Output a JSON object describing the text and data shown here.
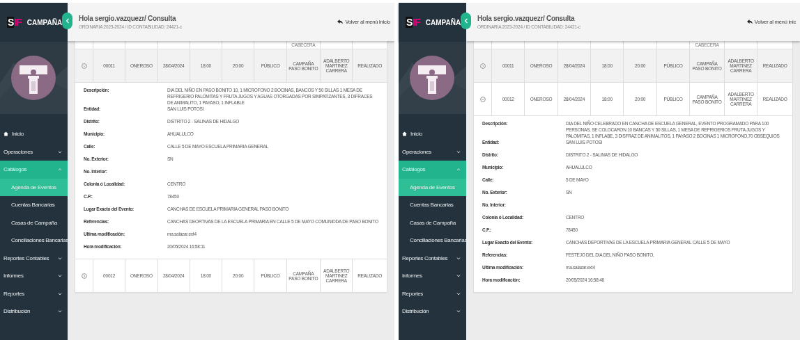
{
  "panels": [
    {
      "logo": {
        "mark_left": "S",
        "mark_right": "IF",
        "brand": "CAMPAÑA"
      },
      "header": {
        "greeting": "Hola sergio.vazquezr/ Consulta",
        "subtitle": "ORDINARIA 2023-2024 / ID CONTABILIDAD: 24421-c",
        "back_link": "Volver al menú inicio"
      },
      "menu": [
        {
          "label": "Inicio",
          "kind": "home",
          "selected": false
        },
        {
          "label": "Operaciones",
          "kind": "group",
          "expanded": false,
          "selected": false
        },
        {
          "label": "Catálogos",
          "kind": "group",
          "expanded": true,
          "selected": true,
          "children": [
            {
              "label": "Agenda de Eventos",
              "selected": true
            },
            {
              "label": "Cuentas Bancarias",
              "selected": false
            },
            {
              "label": "Casas de Campaña",
              "selected": false
            },
            {
              "label": "Conciliaciones Bancarias",
              "selected": false
            }
          ]
        },
        {
          "label": "Reportes Contables",
          "kind": "group",
          "expanded": false,
          "selected": false
        },
        {
          "label": "Informes",
          "kind": "group",
          "expanded": false,
          "selected": false
        },
        {
          "label": "Reportes",
          "kind": "group",
          "expanded": false,
          "selected": false
        },
        {
          "label": "Distribución",
          "kind": "group",
          "expanded": false,
          "selected": false
        }
      ],
      "partial_header": "CABECERA",
      "rows": [
        {
          "cells": [
            "00011",
            "ONEROSO",
            "28/04/2024",
            "18:00",
            "20:00",
            "PÚBLICO",
            "CAMPAÑA PASO BONITO",
            "ADALBERTO MARTINEZ CARRERA",
            "REALIZADO"
          ],
          "expanded": true,
          "details": [
            {
              "label": "Descripción:",
              "value": "DIA DEL NIÑO EN PASO BONITO 10, 1 MICROFONO 2 BOCINAS, BANCOS Y 50 SILLAS 1 MESA DE REFRIGERIO PALOMITAS Y FRUTA JUGOS Y AGUAS OTORGADAS POR SIMPATIZANTES, 3 DIFRACES DE ANIMALITO, 1 PAYASO, 1 INFLABLE"
            },
            {
              "label": "Entidad:",
              "value": "SAN LUIS POTOSI"
            },
            {
              "label": "Distrito:",
              "value": "DISTRITO 2 - SALINAS DE HIDALGO"
            },
            {
              "label": "Municipio:",
              "value": "AHUALULCO"
            },
            {
              "label": "Calle:",
              "value": "CALLE 5 DE MAYO ESCUELA PRIMARIA GENERAL"
            },
            {
              "label": "No. Exterior:",
              "value": "SN"
            },
            {
              "label": "No. Interior:"
            },
            {
              "label": "Colonia ó Localidad:",
              "value": "CENTRO"
            },
            {
              "label": "C.P.:",
              "value": "78450"
            },
            {
              "label": "Lugar Exacto del Evento:",
              "value": "CANCHAS DE ESCUELA PRIMARIA GENERAL PASO BONITO"
            },
            {
              "label": "Referencias:",
              "value": "CANCHAS DEORTIVAS DE LA ESCUELA PRIMARIA EN CALLE 5 DE MAYO COMUNIDDA DE PASO BONITO"
            },
            {
              "label": "Ultima modificación:",
              "value": "ma.salazar.ext4"
            },
            {
              "label": "Hora modificación:",
              "value": "20/05/2024 16:58:11"
            }
          ]
        },
        {
          "cells": [
            "00012",
            "ONEROSO",
            "28/04/2024",
            "18:00",
            "20:00",
            "PÚBLICO",
            "CAMPAÑA PASO BONITO",
            "ADALBERTO MARTINEZ CARRERA",
            "REALIZADO"
          ],
          "expanded": false
        }
      ]
    },
    {
      "logo": {
        "mark_left": "S",
        "mark_right": "IF",
        "brand": "CAMPAÑA"
      },
      "header": {
        "greeting": "Hola sergio.vazquezr/ Consulta",
        "subtitle": "ORDINARIA 2023-2024 / ID CONTABILIDAD: 24421-c",
        "back_link": "Volver al menú inic"
      },
      "menu": [
        {
          "label": "Inicio",
          "kind": "home",
          "selected": false
        },
        {
          "label": "Operaciones",
          "kind": "group",
          "expanded": false,
          "selected": false
        },
        {
          "label": "Catálogos",
          "kind": "group",
          "expanded": true,
          "selected": true,
          "children": [
            {
              "label": "Agenda de Eventos",
              "selected": true
            },
            {
              "label": "Cuentas Bancarias",
              "selected": false
            },
            {
              "label": "Casas de Campaña",
              "selected": false
            },
            {
              "label": "Conciliaciones Bancarias",
              "selected": false
            }
          ]
        },
        {
          "label": "Reportes Contables",
          "kind": "group",
          "expanded": false,
          "selected": false
        },
        {
          "label": "Informes",
          "kind": "group",
          "expanded": false,
          "selected": false
        },
        {
          "label": "Reportes",
          "kind": "group",
          "expanded": false,
          "selected": false
        },
        {
          "label": "Distribución",
          "kind": "group",
          "expanded": false,
          "selected": false
        }
      ],
      "partial_header": "CABECERA",
      "rows": [
        {
          "cells": [
            "00011",
            "ONEROSO",
            "28/04/2024",
            "18:00",
            "20:00",
            "PÚBLICO",
            "CAMPAÑA PASO BONITO",
            "ADALBERTO MARTINEZ CARRERA",
            "REALIZADO"
          ],
          "expanded": false
        },
        {
          "cells": [
            "00012",
            "ONEROSO",
            "28/04/2024",
            "18:00",
            "20:00",
            "PÚBLICO",
            "CAMPAÑA PASO BONITO",
            "ADALBERTO MARTINEZ CARRERA",
            "REALIZADO"
          ],
          "expanded": true,
          "details": [
            {
              "label": "Descripción:",
              "value": "DIA DEL NIÑO CELEBRADO EN CANCHA DE ESCUELA GENERAL, EVENTO PROGRAMADO PARA 100 PERSONAS, SE COLOCARON 10 BANCAS Y 50 SILLAS, 1 MESA DE REFRIGERIOS FRUTA JUGOS Y PALOMITAS, 1 INFLABE, 3 DISFRAZ DE ANIMALITOS, 1 PAYASO 2 BOCINAS 1 MICROFONO,70 OBSEQUIOS"
            },
            {
              "label": "Entidad:",
              "value": "SAN LUIS POTOSI"
            },
            {
              "label": "Distrito:",
              "value": "DISTRITO 2 - SALINAS DE HIDALGO"
            },
            {
              "label": "Municipio:",
              "value": "AHUALULCO"
            },
            {
              "label": "Calle:",
              "value": "5 DE MAYO"
            },
            {
              "label": "No. Exterior:",
              "value": "SN"
            },
            {
              "label": "No. Interior:"
            },
            {
              "label": "Colonia ó Localidad:",
              "value": "CENTRO"
            },
            {
              "label": "C.P.:",
              "value": "78450"
            },
            {
              "label": "Lugar Exacto del Evento:",
              "value": "CANCHAS DEPORTIVAS DE LA ESCUELA PRIMARIA GENERAL CALLE 5 DE MAYO"
            },
            {
              "label": "Referencias:",
              "value": "FESTEJO DEL DIA DEL NIÑO PASO BONITO,"
            },
            {
              "label": "Ultima modificación:",
              "value": "ma.salazar.ext4"
            },
            {
              "label": "Hora modificación:",
              "value": "20/05/2024 16:58:46"
            }
          ]
        }
      ]
    }
  ]
}
